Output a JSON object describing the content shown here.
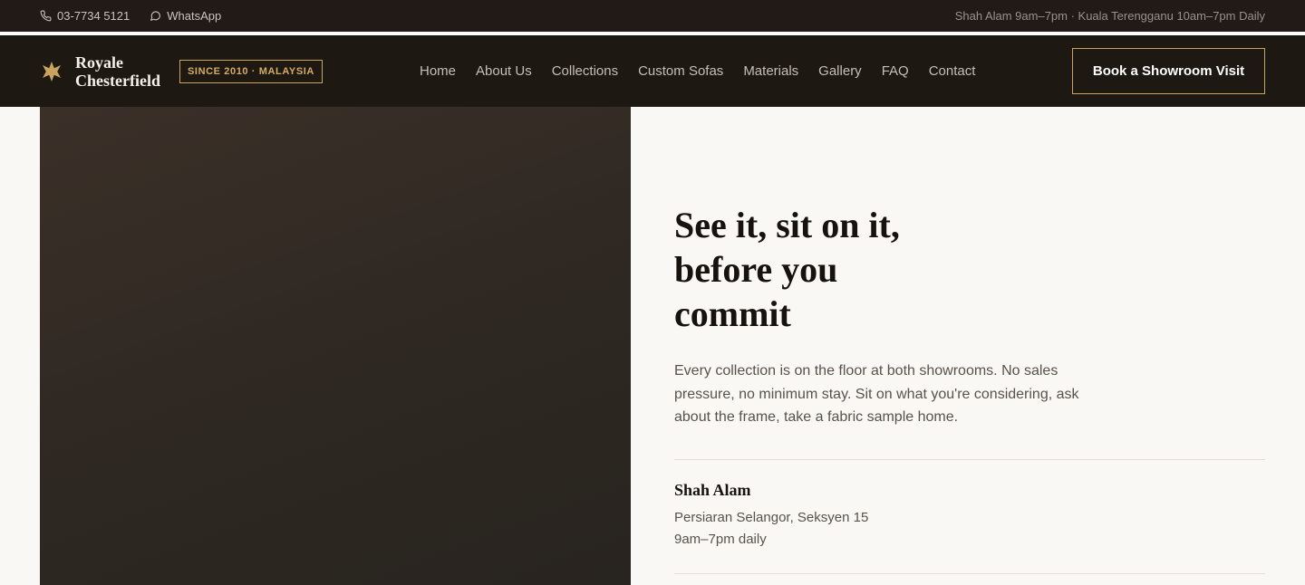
{
  "topbar": {
    "phone": "03-7734 5121",
    "whatsapp": "WhatsApp",
    "hours": "Shah Alam 9am–7pm · Kuala Terengganu 10am–7pm Daily"
  },
  "brand": {
    "name_line1": "Royale",
    "name_line2": "Chesterfield",
    "badge": "SINCE 2010 · MALAYSIA"
  },
  "nav": {
    "items": [
      {
        "label": "Home"
      },
      {
        "label": "About Us"
      },
      {
        "label": "Collections"
      },
      {
        "label": "Custom Sofas"
      },
      {
        "label": "Materials"
      },
      {
        "label": "Gallery"
      },
      {
        "label": "FAQ"
      },
      {
        "label": "Contact"
      }
    ],
    "cta": "Book a Showroom Visit"
  },
  "hero": {
    "title_line1": "See it, sit on it,",
    "title_line2": "before you",
    "title_line3": "commit",
    "description": "Every collection is on the floor at both showrooms. No sales pressure, no minimum stay. Sit on what you're considering, ask about the frame, take a fabric sample home.",
    "locations": [
      {
        "name": "Shah Alam",
        "address": "Persiaran Selangor, Seksyen 15",
        "hours": "9am–7pm daily"
      }
    ]
  },
  "colors": {
    "accent": "#c9a45f",
    "dark": "#1e1813",
    "background": "#f9f8f5"
  }
}
